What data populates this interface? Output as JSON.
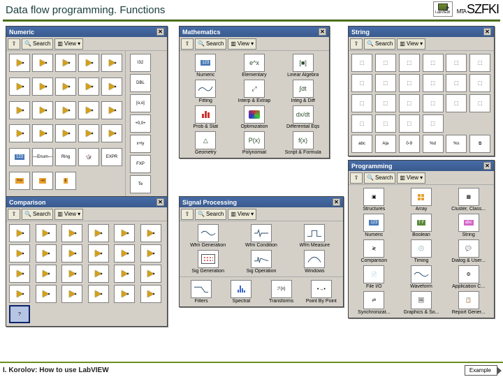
{
  "header": {
    "title": "Data flow programming. Functions",
    "labview_label": "LabVIEW",
    "szfki_small": "MTA",
    "szfki": "SZFKI"
  },
  "toolbar": {
    "up": "⇧",
    "search": "Search",
    "view": "View"
  },
  "palettes": {
    "numeric": {
      "title": "Numeric",
      "side": [
        "I32",
        "DBL",
        "[o,o]",
        "+0,0+",
        "x+iy",
        "EXPR"
      ],
      "bottom": [
        "123",
        "—Enum—",
        "Ring",
        "",
        "",
        "FXP",
        "",
        "",
        "",
        "Te"
      ]
    },
    "mathematics": {
      "title": "Mathematics",
      "items": [
        {
          "lbl": "Numeric",
          "g": "123"
        },
        {
          "lbl": "Elementary",
          "g": "e^x"
        },
        {
          "lbl": "Linear Algebra",
          "g": "[■]"
        },
        {
          "lbl": "Fitting",
          "g": "∿"
        },
        {
          "lbl": "Interp & Extrap",
          "g": "⤢"
        },
        {
          "lbl": "Integ & Diff",
          "g": "∫dt"
        },
        {
          "lbl": "Prob & Stat",
          "g": "▮▮"
        },
        {
          "lbl": "Optimization",
          "g": "◈"
        },
        {
          "lbl": "Differential Eqs",
          "g": "dx/dt"
        },
        {
          "lbl": "Geometry",
          "g": "△"
        },
        {
          "lbl": "Polynomial",
          "g": "P(x)"
        },
        {
          "lbl": "Script & Formula",
          "g": "f(x)"
        }
      ]
    },
    "string": {
      "title": "String",
      "row6": [
        "abc",
        "A|a",
        "0-9",
        "%d",
        "%s",
        "⧉"
      ]
    },
    "comparison": {
      "title": "Comparison"
    },
    "signal": {
      "title": "Signal Processing",
      "items": [
        {
          "lbl": "Wfm Generation"
        },
        {
          "lbl": "Wfm Condition"
        },
        {
          "lbl": "Wfm Measure"
        },
        {
          "lbl": "Sig Generation"
        },
        {
          "lbl": "Sig Operation"
        },
        {
          "lbl": "Windows"
        },
        {
          "lbl": "Filters"
        },
        {
          "lbl": "Spectral"
        },
        {
          "lbl": "Transforms"
        },
        {
          "lbl": "Point By Point"
        }
      ]
    },
    "programming": {
      "title": "Programming",
      "items": [
        {
          "lbl": "Structures"
        },
        {
          "lbl": "Array"
        },
        {
          "lbl": "Cluster, Class..."
        },
        {
          "lbl": "Numeric"
        },
        {
          "lbl": "Boolean"
        },
        {
          "lbl": "String"
        },
        {
          "lbl": "Comparison"
        },
        {
          "lbl": "Timing"
        },
        {
          "lbl": "Dialog & User..."
        },
        {
          "lbl": "File I/O"
        },
        {
          "lbl": "Waveform"
        },
        {
          "lbl": "Application C..."
        },
        {
          "lbl": "Synchronizat..."
        },
        {
          "lbl": "Graphics & So..."
        },
        {
          "lbl": "Report Gener..."
        }
      ]
    }
  },
  "footer": {
    "text": "I. Korolov: How to use LabVIEW",
    "example": "Example"
  }
}
